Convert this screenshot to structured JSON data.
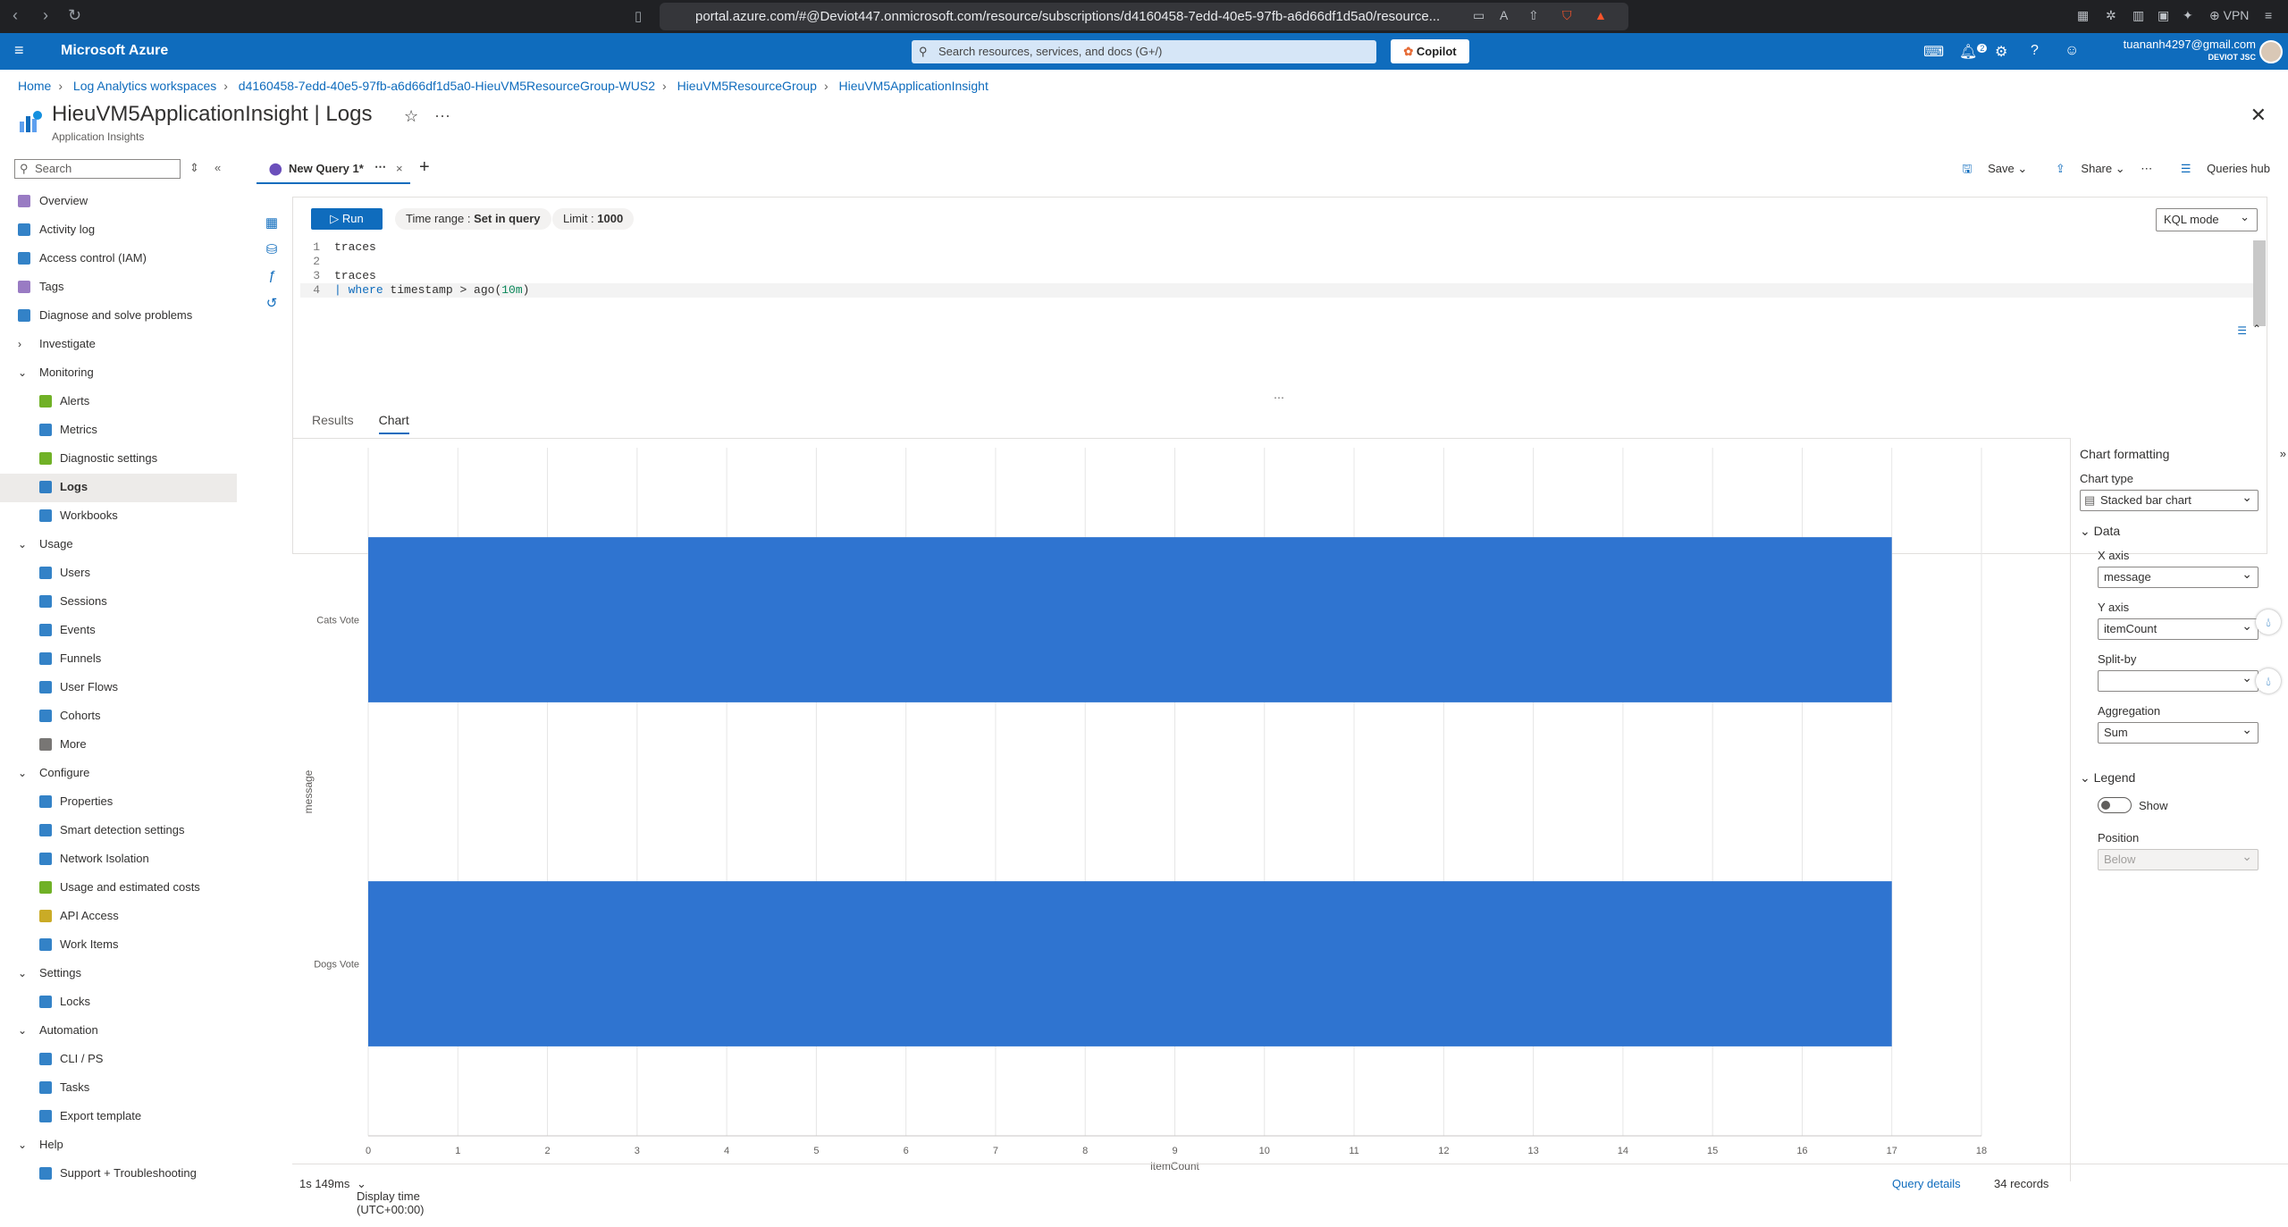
{
  "browser": {
    "url": "portal.azure.com/#@Deviot447.onmicrosoft.com/resource/subscriptions/d4160458-7edd-40e5-97fb-a6d66df1d5a0/resource...",
    "vpn_label": "VPN"
  },
  "azure": {
    "brand": "Microsoft Azure",
    "search_placeholder": "Search resources, services, and docs (G+/)",
    "copilot_label": "Copilot",
    "notif_count": "2",
    "user_email": "tuananh4297@gmail.com",
    "user_org": "DEVIOT JSC"
  },
  "breadcrumb": [
    "Home",
    "Log Analytics workspaces",
    "d4160458-7edd-40e5-97fb-a6d66df1d5a0-HieuVM5ResourceGroup-WUS2",
    "HieuVM5ResourceGroup",
    "HieuVM5ApplicationInsight"
  ],
  "page": {
    "title": "HieuVM5ApplicationInsight | Logs",
    "subtitle": "Application Insights"
  },
  "sidebar": {
    "search_placeholder": "Search",
    "items": [
      {
        "label": "Overview",
        "level": 0,
        "icon": "lightbulb-icon",
        "color": "#8764b8"
      },
      {
        "label": "Activity log",
        "level": 0,
        "icon": "activity-log-icon",
        "color": "#0f6cbd"
      },
      {
        "label": "Access control (IAM)",
        "level": 0,
        "icon": "people-icon",
        "color": "#0f6cbd"
      },
      {
        "label": "Tags",
        "level": 0,
        "icon": "tag-icon",
        "color": "#8764b8"
      },
      {
        "label": "Diagnose and solve problems",
        "level": 0,
        "icon": "wrench-icon",
        "color": "#0f6cbd"
      },
      {
        "label": "Investigate",
        "level": 0,
        "chevron": "›"
      },
      {
        "label": "Monitoring",
        "level": 0,
        "chevron": "⌄"
      },
      {
        "label": "Alerts",
        "level": 1,
        "icon": "alerts-icon",
        "color": "#57a300"
      },
      {
        "label": "Metrics",
        "level": 1,
        "icon": "metrics-icon",
        "color": "#0f6cbd"
      },
      {
        "label": "Diagnostic settings",
        "level": 1,
        "icon": "diagnostic-icon",
        "color": "#57a300"
      },
      {
        "label": "Logs",
        "level": 1,
        "icon": "logs-icon",
        "color": "#0f6cbd",
        "selected": true
      },
      {
        "label": "Workbooks",
        "level": 1,
        "icon": "workbooks-icon",
        "color": "#0f6cbd"
      },
      {
        "label": "Usage",
        "level": 0,
        "chevron": "⌄"
      },
      {
        "label": "Users",
        "level": 1,
        "icon": "user-icon",
        "color": "#0f6cbd"
      },
      {
        "label": "Sessions",
        "level": 1,
        "icon": "sessions-icon",
        "color": "#0f6cbd"
      },
      {
        "label": "Events",
        "level": 1,
        "icon": "events-icon",
        "color": "#0f6cbd"
      },
      {
        "label": "Funnels",
        "level": 1,
        "icon": "funnel-icon",
        "color": "#0f6cbd"
      },
      {
        "label": "User Flows",
        "level": 1,
        "icon": "flows-icon",
        "color": "#0f6cbd"
      },
      {
        "label": "Cohorts",
        "level": 1,
        "icon": "cohorts-icon",
        "color": "#0f6cbd"
      },
      {
        "label": "More",
        "level": 1,
        "icon": "more-icon",
        "color": "#605e5c"
      },
      {
        "label": "Configure",
        "level": 0,
        "chevron": "⌄"
      },
      {
        "label": "Properties",
        "level": 1,
        "icon": "properties-icon",
        "color": "#0f6cbd"
      },
      {
        "label": "Smart detection settings",
        "level": 1,
        "icon": "smart-detection-icon",
        "color": "#0f6cbd"
      },
      {
        "label": "Network Isolation",
        "level": 1,
        "icon": "network-icon",
        "color": "#0f6cbd"
      },
      {
        "label": "Usage and estimated costs",
        "level": 1,
        "icon": "costs-icon",
        "color": "#57a300"
      },
      {
        "label": "API Access",
        "level": 1,
        "icon": "key-icon",
        "color": "#c19c00"
      },
      {
        "label": "Work Items",
        "level": 1,
        "icon": "work-items-icon",
        "color": "#0f6cbd"
      },
      {
        "label": "Settings",
        "level": 0,
        "chevron": "⌄"
      },
      {
        "label": "Locks",
        "level": 1,
        "icon": "lock-icon",
        "color": "#0f6cbd"
      },
      {
        "label": "Automation",
        "level": 0,
        "chevron": "⌄"
      },
      {
        "label": "CLI / PS",
        "level": 1,
        "icon": "cli-icon",
        "color": "#0f6cbd"
      },
      {
        "label": "Tasks",
        "level": 1,
        "icon": "tasks-icon",
        "color": "#0f6cbd"
      },
      {
        "label": "Export template",
        "level": 1,
        "icon": "export-icon",
        "color": "#0f6cbd"
      },
      {
        "label": "Help",
        "level": 0,
        "chevron": "⌄"
      },
      {
        "label": "Support + Troubleshooting",
        "level": 1,
        "icon": "support-icon",
        "color": "#0f6cbd"
      }
    ]
  },
  "query_tab": {
    "label": "New Query 1*"
  },
  "toolbar": {
    "save": "Save",
    "share": "Share",
    "queries_hub": "Queries hub"
  },
  "editor": {
    "run_label": "Run",
    "time_range_label": "Time range :",
    "time_range_value": "Set in query",
    "limit_label": "Limit :",
    "limit_value": "1000",
    "mode": "KQL mode",
    "lines": [
      {
        "n": "1",
        "text": "traces"
      },
      {
        "n": "2",
        "text": ""
      },
      {
        "n": "3",
        "text": "traces"
      },
      {
        "n": "4",
        "pipe": "| ",
        "kw": "where",
        "mid": " timestamp > ago(",
        "num": "10m",
        "end": ")"
      }
    ]
  },
  "results_tabs": {
    "results": "Results",
    "chart": "Chart"
  },
  "chart_data": {
    "type": "bar",
    "orientation": "horizontal",
    "categories": [
      "Cats Vote",
      "Dogs Vote"
    ],
    "values": [
      17,
      17
    ],
    "xlabel": "itemCount",
    "ylabel": "message",
    "xlim": [
      0,
      18
    ],
    "xticks": [
      0,
      1,
      2,
      3,
      4,
      5,
      6,
      7,
      8,
      9,
      10,
      11,
      12,
      13,
      14,
      15,
      16,
      17,
      18
    ],
    "color": "#2f74d0",
    "grid": true
  },
  "chart_formatting": {
    "title": "Chart formatting",
    "chart_type_label": "Chart type",
    "chart_type_value": "Stacked bar chart",
    "data_label": "Data",
    "x_axis_label": "X axis",
    "x_axis_value": "message",
    "y_axis_label": "Y axis",
    "y_axis_value": "itemCount",
    "split_by_label": "Split-by",
    "split_by_value": "",
    "aggregation_label": "Aggregation",
    "aggregation_value": "Sum",
    "legend_label": "Legend",
    "legend_show_label": "Show",
    "position_label": "Position",
    "position_value": "Below"
  },
  "status": {
    "duration": "1s 149ms",
    "display_time": "Display time (UTC+00:00)",
    "query_details": "Query details",
    "records": "34 records"
  }
}
